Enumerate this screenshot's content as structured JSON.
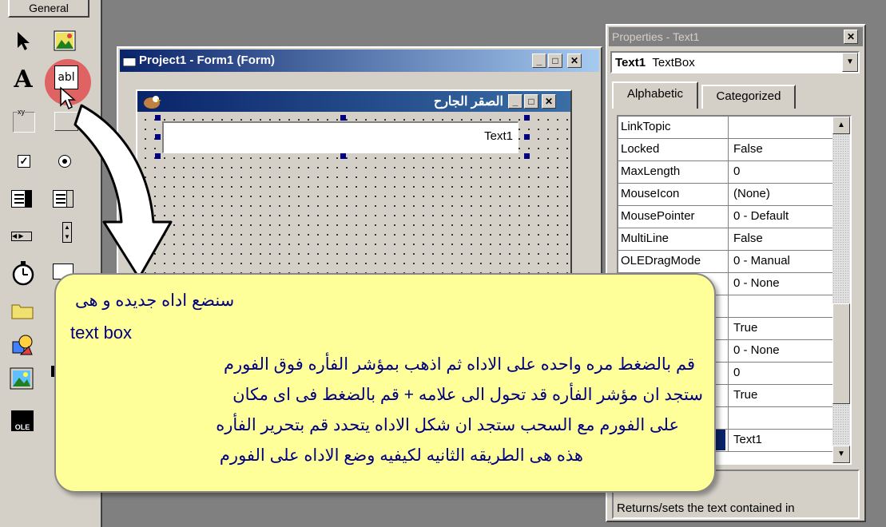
{
  "toolbox": {
    "tab_label": "General"
  },
  "project_window": {
    "title": "Project1 - Form1 (Form)"
  },
  "form": {
    "caption": "الصقر الجارح",
    "textbox_text": "Text1"
  },
  "properties": {
    "title": "Properties - Text1",
    "object_name": "Text1",
    "object_type": "TextBox",
    "tabs": [
      "Alphabetic",
      "Categorized"
    ],
    "rows": [
      {
        "name": "LinkTopic",
        "value": ""
      },
      {
        "name": "Locked",
        "value": "False"
      },
      {
        "name": "MaxLength",
        "value": "0"
      },
      {
        "name": "MouseIcon",
        "value": "(None)"
      },
      {
        "name": "MousePointer",
        "value": "0 - Default"
      },
      {
        "name": "MultiLine",
        "value": "False"
      },
      {
        "name": "OLEDragMode",
        "value": "0 - Manual"
      },
      {
        "name": "",
        "value": "0 - None"
      },
      {
        "name": "",
        "value": ""
      },
      {
        "name": "",
        "value": "True"
      },
      {
        "name": "",
        "value": "0 - None"
      },
      {
        "name": "",
        "value": "0"
      },
      {
        "name": "",
        "value": "True"
      },
      {
        "name": "",
        "value": ""
      },
      {
        "name": "",
        "value": "Text1"
      }
    ],
    "description": "Returns/sets the text contained in"
  },
  "callout": {
    "line1": "سنضع اداه جديده و هى",
    "line2": "text box",
    "line3": "قم بالضغط مره واحده على الاداه ثم اذهب بمؤشر الفأره فوق الفورم",
    "line4": "ستجد ان مؤشر الفأره قد تحول الى علامه +  قم بالضغط فى اى مكان",
    "line5": "على الفورم مع السحب ستجد ان شكل الاداه يتحدد  قم بتحرير الفأره",
    "line6": "هذه هى الطريقه الثانيه لكيفيه وضع الاداه على الفورم"
  },
  "colors": {
    "titlebar": "#0a246a",
    "callout_bg": "#ffff99",
    "callout_text": "#000080",
    "highlight": "#e05050"
  }
}
